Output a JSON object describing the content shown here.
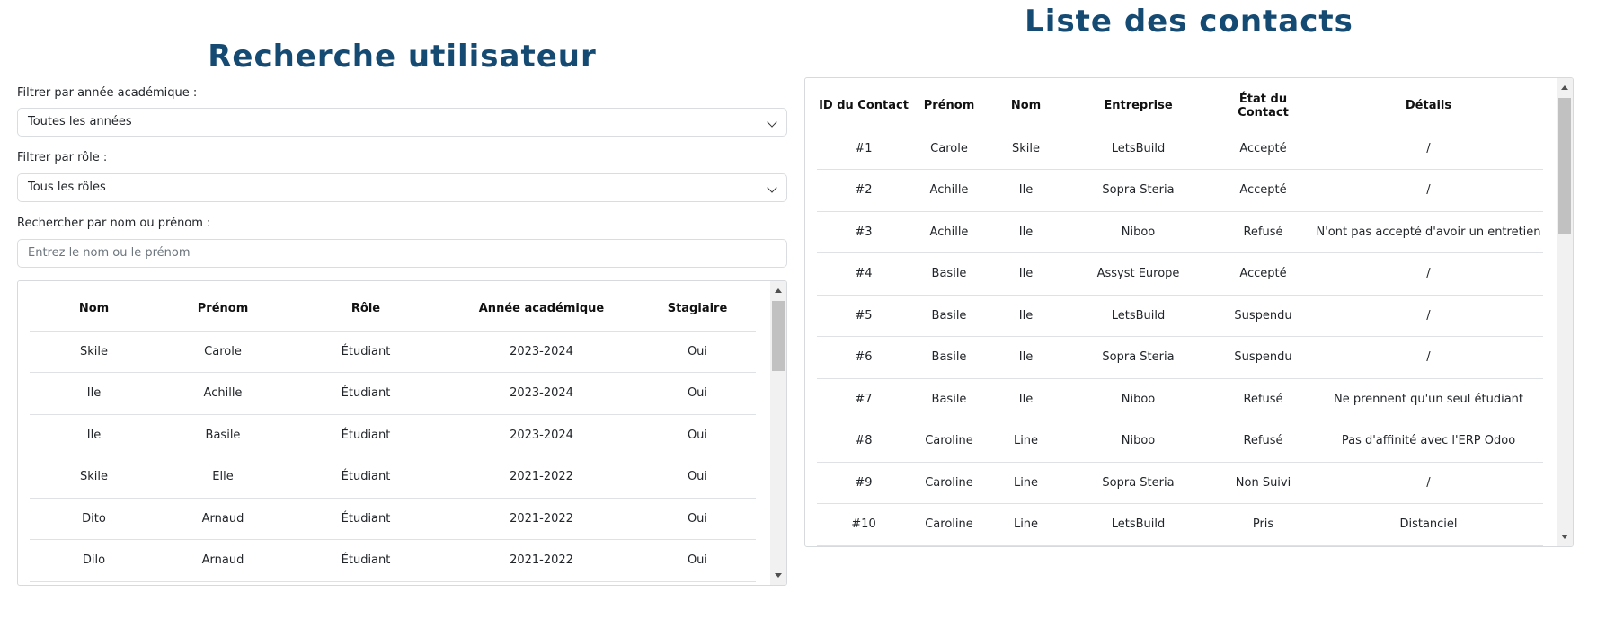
{
  "left": {
    "title": "Recherche utilisateur",
    "year_filter": {
      "label": "Filtrer par année académique :",
      "value": "Toutes les années"
    },
    "role_filter": {
      "label": "Filtrer par rôle :",
      "value": "Tous les rôles"
    },
    "search": {
      "label": "Rechercher par nom ou prénom :",
      "placeholder": "Entrez le nom ou le prénom"
    },
    "table": {
      "headers": [
        "Nom",
        "Prénom",
        "Rôle",
        "Année académique",
        "Stagiaire"
      ],
      "rows": [
        [
          "Skile",
          "Carole",
          "Étudiant",
          "2023-2024",
          "Oui"
        ],
        [
          "Ile",
          "Achille",
          "Étudiant",
          "2023-2024",
          "Oui"
        ],
        [
          "Ile",
          "Basile",
          "Étudiant",
          "2023-2024",
          "Oui"
        ],
        [
          "Skile",
          "Elle",
          "Étudiant",
          "2021-2022",
          "Oui"
        ],
        [
          "Dito",
          "Arnaud",
          "Étudiant",
          "2021-2022",
          "Oui"
        ],
        [
          "Dilo",
          "Arnaud",
          "Étudiant",
          "2021-2022",
          "Oui"
        ]
      ]
    }
  },
  "right": {
    "title": "Liste des contacts",
    "table": {
      "headers": [
        "ID du Contact",
        "Prénom",
        "Nom",
        "Entreprise",
        "État du Contact",
        "Détails"
      ],
      "rows": [
        [
          "#1",
          "Carole",
          "Skile",
          "LetsBuild",
          "Accepté",
          "/"
        ],
        [
          "#2",
          "Achille",
          "Ile",
          "Sopra Steria",
          "Accepté",
          "/"
        ],
        [
          "#3",
          "Achille",
          "Ile",
          "Niboo",
          "Refusé",
          "N'ont pas accepté d'avoir un entretien"
        ],
        [
          "#4",
          "Basile",
          "Ile",
          "Assyst Europe",
          "Accepté",
          "/"
        ],
        [
          "#5",
          "Basile",
          "Ile",
          "LetsBuild",
          "Suspendu",
          "/"
        ],
        [
          "#6",
          "Basile",
          "Ile",
          "Sopra Steria",
          "Suspendu",
          "/"
        ],
        [
          "#7",
          "Basile",
          "Ile",
          "Niboo",
          "Refusé",
          "Ne prennent qu'un seul étudiant"
        ],
        [
          "#8",
          "Caroline",
          "Line",
          "Niboo",
          "Refusé",
          "Pas d'affinité avec l'ERP Odoo"
        ],
        [
          "#9",
          "Caroline",
          "Line",
          "Sopra Steria",
          "Non Suivi",
          "/"
        ],
        [
          "#10",
          "Caroline",
          "Line",
          "LetsBuild",
          "Pris",
          "Distanciel"
        ]
      ]
    }
  },
  "colors": {
    "title": "#154a73",
    "border": "#dee2e6"
  },
  "icons": {
    "select_chevron": "chevron-down-icon"
  }
}
